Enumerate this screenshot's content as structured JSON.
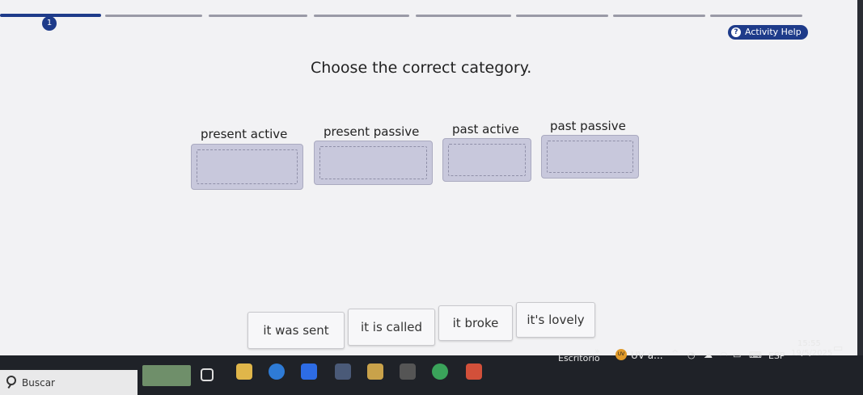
{
  "progress": {
    "current_step": "1",
    "total_segments": 8,
    "completed_segments": 1
  },
  "help": {
    "label": "Activity Help",
    "icon": "question-circle-icon"
  },
  "prompt": "Choose the correct category.",
  "categories": [
    {
      "label": "present active"
    },
    {
      "label": "present passive"
    },
    {
      "label": "past active"
    },
    {
      "label": "past passive"
    }
  ],
  "answers": [
    {
      "label": "it was sent"
    },
    {
      "label": "it is called"
    },
    {
      "label": "it broke"
    },
    {
      "label": "it's lovely"
    }
  ],
  "taskbar": {
    "search_label": "Buscar",
    "desktop_label": "Escritorio",
    "overflow_glyph": "»",
    "app_badge": "UV",
    "app_label": "UV a...",
    "language": "ESP",
    "time": "15:55",
    "date": "19/5/2025",
    "pinned_icons": [
      "task-view-icon",
      "files-icon",
      "edge-icon",
      "zoom-icon",
      "calculator-icon",
      "photos-icon",
      "apps-icon",
      "chrome-icon",
      "powerpoint-icon"
    ]
  },
  "colors": {
    "accent": "#1e3b8a",
    "dropzone": "#c8c8dc",
    "background": "#f2f2f4"
  }
}
